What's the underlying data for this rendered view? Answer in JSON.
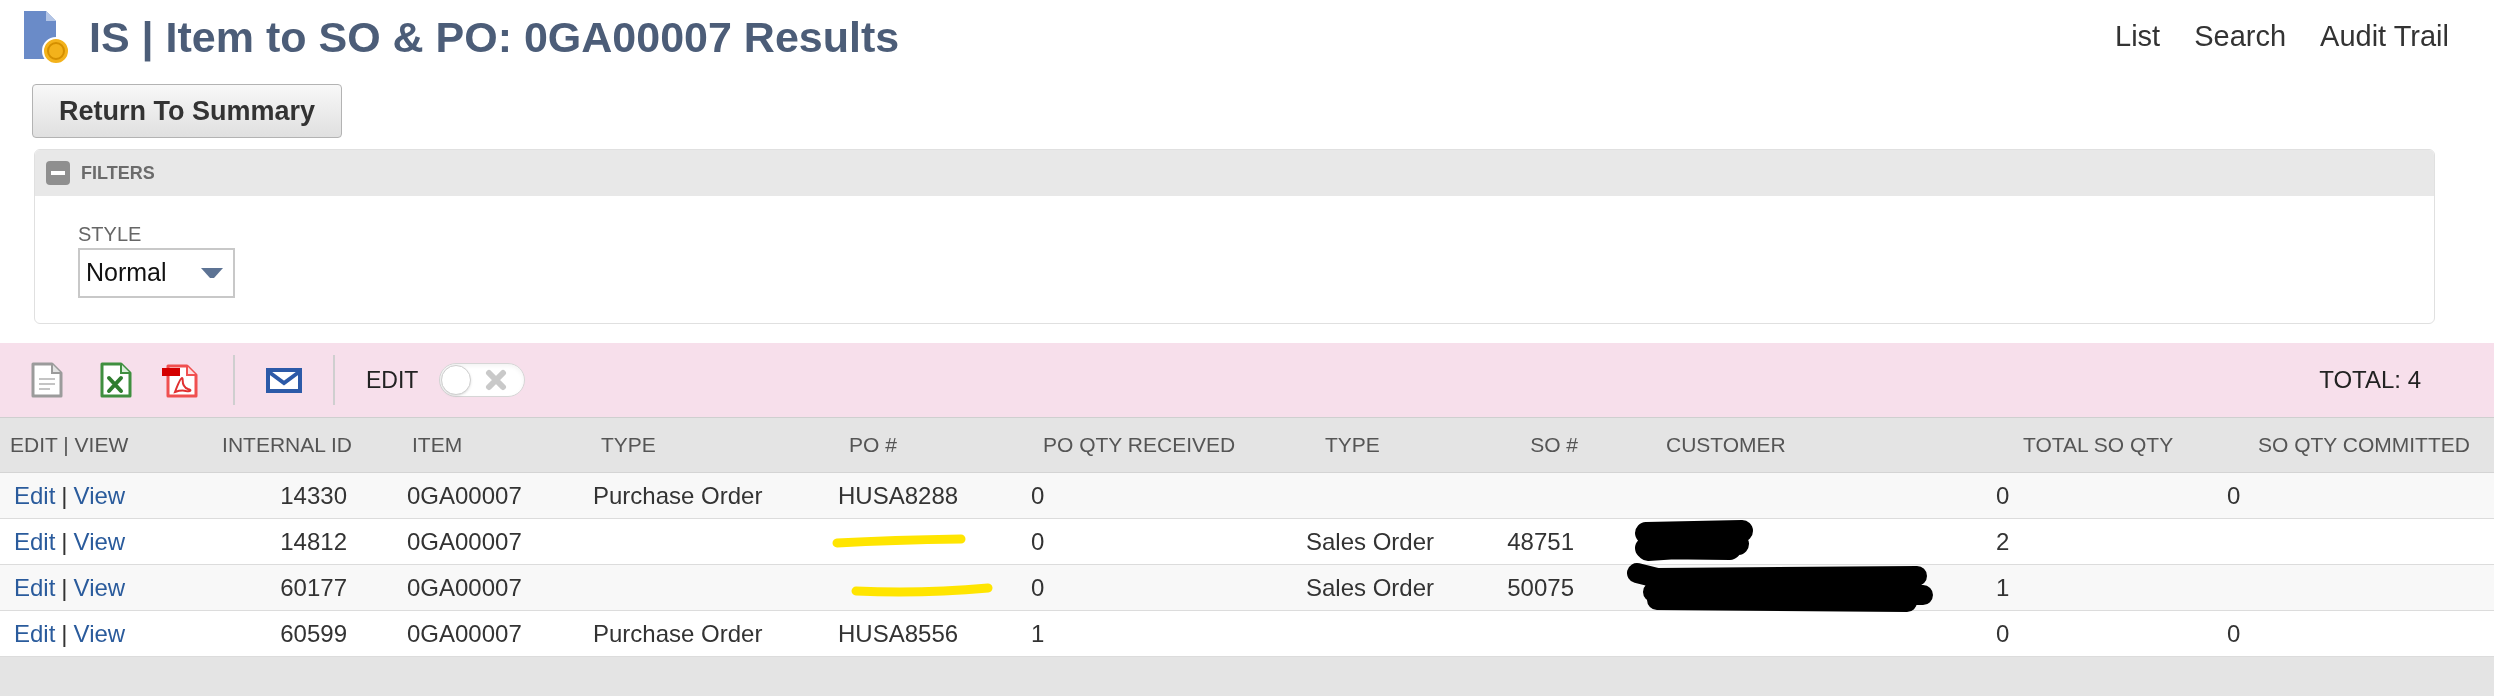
{
  "page": {
    "title": "IS | Item to SO & PO: 0GA00007 Results",
    "nav_links": [
      "List",
      "Search",
      "Audit Trail"
    ]
  },
  "return_button": "Return To Summary",
  "filters": {
    "title": "FILTERS",
    "expanded": true,
    "style_field": {
      "label": "STYLE",
      "value": "Normal"
    }
  },
  "toolbar": {
    "edit_toggle": {
      "label": "EDIT",
      "on": false
    },
    "total": "TOTAL: 4"
  },
  "table": {
    "columns": [
      "EDIT | VIEW",
      "INTERNAL ID",
      "ITEM",
      "TYPE",
      "PO #",
      "PO QTY RECEIVED",
      "TYPE",
      "SO #",
      "CUSTOMER",
      "TOTAL SO QTY",
      "SO QTY COMMITTED"
    ],
    "rows": [
      {
        "links": [
          "Edit",
          "View"
        ],
        "separator": "|",
        "internal_id": "14330",
        "item": "0GA00007",
        "type": "Purchase Order",
        "po_number": "HUSA8288",
        "po_qty_received": "0",
        "total_so_qty": "0",
        "so_qty_committed": "0",
        "po_scribble": false,
        "customer_scribble": false
      },
      {
        "links": [
          "Edit",
          "View"
        ],
        "separator": "|",
        "internal_id": "14812",
        "item": "0GA00007",
        "po_qty_received": "0",
        "type_2": "Sales Order",
        "so_number": "48751",
        "total_so_qty": "2",
        "po_scribble": true,
        "customer_scribble": true
      },
      {
        "links": [
          "Edit",
          "View"
        ],
        "separator": "|",
        "internal_id": "60177",
        "item": "0GA00007",
        "po_qty_received": "0",
        "type_2": "Sales Order",
        "so_number": "50075",
        "total_so_qty": "1",
        "po_scribble": true,
        "customer_scribble": true
      },
      {
        "links": [
          "Edit",
          "View"
        ],
        "separator": "|",
        "internal_id": "60599",
        "item": "0GA00007",
        "type": "Purchase Order",
        "po_number": "HUSA8556",
        "po_qty_received": "1",
        "total_so_qty": "0",
        "so_qty_committed": "0",
        "po_scribble": false,
        "customer_scribble": false
      }
    ]
  }
}
